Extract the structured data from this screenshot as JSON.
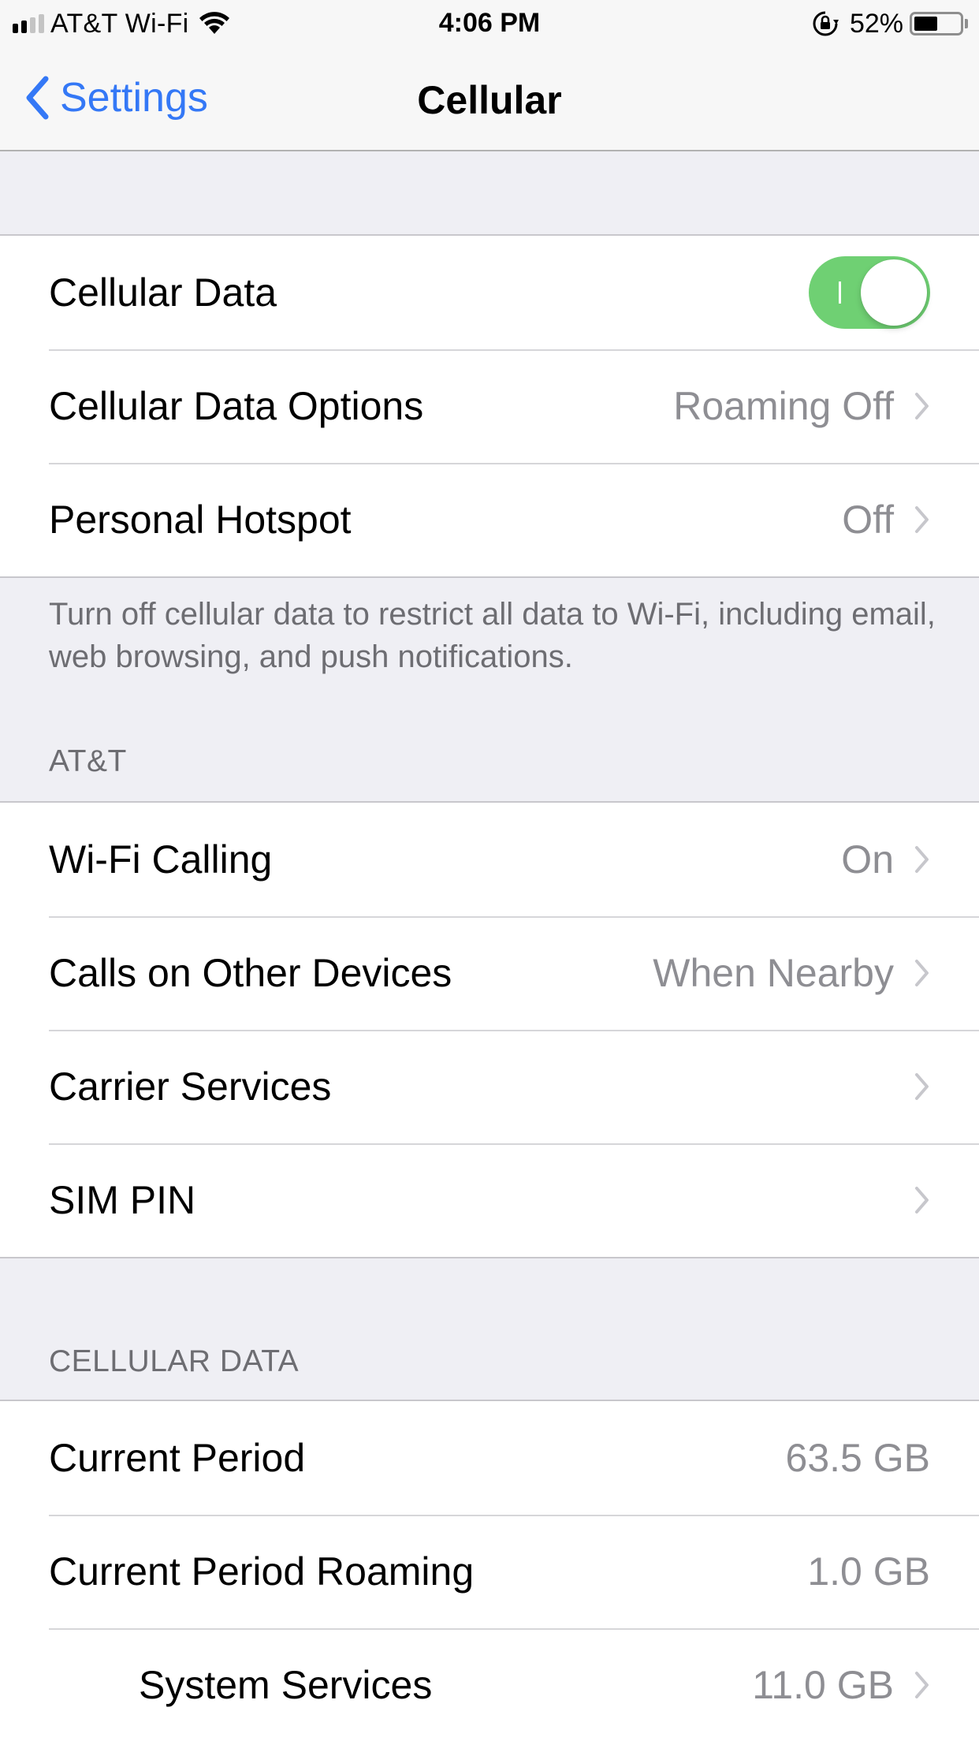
{
  "status_bar": {
    "signal_bars_filled": 2,
    "signal_bars_total": 4,
    "carrier": "AT&T Wi-Fi",
    "wifi_icon": "wifi-icon",
    "time": "4:06 PM",
    "rotation_lock_icon": "rotation-lock-icon",
    "battery_percent_label": "52%",
    "battery_level": 0.52
  },
  "nav": {
    "back_label": "Settings",
    "title": "Cellular"
  },
  "group_main": {
    "cellular_data": {
      "label": "Cellular Data",
      "toggle_on": true,
      "toggle_color": "#6fd073"
    },
    "cellular_data_options": {
      "label": "Cellular Data Options",
      "value": "Roaming Off"
    },
    "personal_hotspot": {
      "label": "Personal Hotspot",
      "value": "Off"
    },
    "footer": "Turn off cellular data to restrict all data to Wi-Fi, including email, web browsing, and push notifications."
  },
  "group_carrier": {
    "header": "AT&T",
    "items": [
      {
        "label": "Wi-Fi Calling",
        "value": "On"
      },
      {
        "label": "Calls on Other Devices",
        "value": "When Nearby"
      },
      {
        "label": "Carrier Services",
        "value": ""
      },
      {
        "label": "SIM PIN",
        "value": ""
      }
    ]
  },
  "group_usage": {
    "header": "CELLULAR DATA",
    "items": [
      {
        "label": "Current Period",
        "value": "63.5 GB"
      },
      {
        "label": "Current Period Roaming",
        "value": "1.0 GB"
      },
      {
        "label": "System Services",
        "value": "11.0 GB"
      }
    ]
  },
  "colors": {
    "accent": "#3478f6",
    "background": "#efeff4",
    "secondary_text": "#8e8e93"
  }
}
